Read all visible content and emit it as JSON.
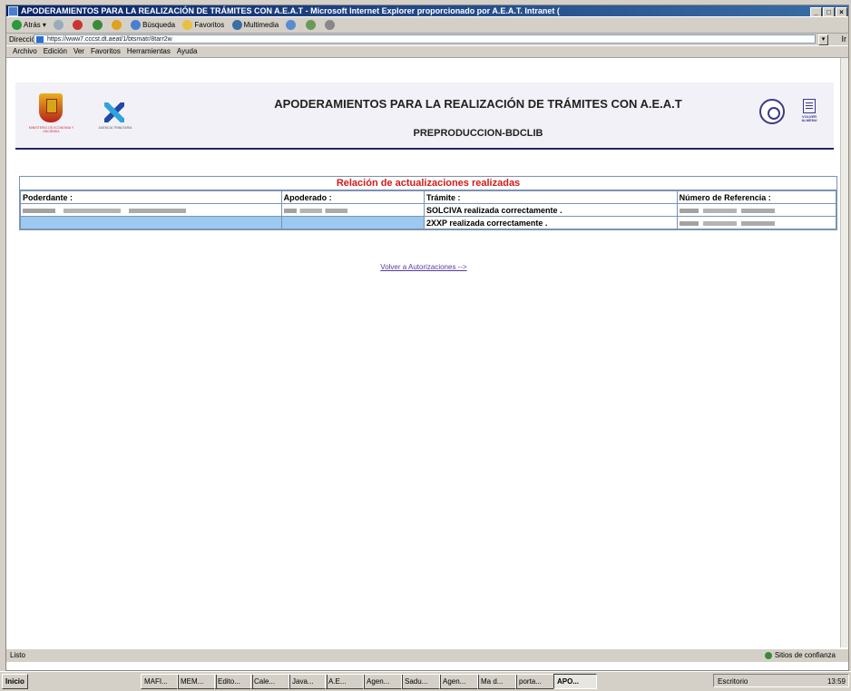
{
  "window": {
    "title": "APODERAMIENTOS PARA LA REALIZACIÓN DE TRÁMITES CON A.E.A.T - Microsoft Internet Explorer proporcionado por A.E.A.T. Intranet (",
    "controls": [
      "_",
      "□",
      "×"
    ]
  },
  "toolbar": {
    "back": "Atrás",
    "search": "Búsqueda",
    "favorites": "Favoritos",
    "multimedia": "Multimedia"
  },
  "address": {
    "label": "Dirección",
    "value": "https://www7.cccst.dt.aeat/1/btsmatr/8tarr2w",
    "go": "Ir"
  },
  "menu": [
    "Archivo",
    "Edición",
    "Ver",
    "Favoritos",
    "Herramientas",
    "Ayuda"
  ],
  "header": {
    "title": "APODERAMIENTOS PARA LA REALIZACIÓN DE TRÁMITES CON A.E.A.T",
    "subtitle": "PREPRODUCCION-BDCLIB",
    "min_text": "MINISTERIO DE ECONOMIA Y HACIENDA",
    "aeat_text": "AGENCIA TRIBUTARIA",
    "volver_text": "VOLVER ALMENU"
  },
  "results": {
    "title": "Relación de actualizaciones realizadas",
    "columns": [
      "Poderdante :",
      "Apoderado :",
      "Trámite :",
      "Número de Referencia :"
    ],
    "rows": [
      {
        "tramite": "SOLCIVA   realizada correctamente ."
      },
      {
        "tramite": "2XXP   realizada correctamente ."
      }
    ]
  },
  "link": {
    "label": "Volver a Autorizaciones -->"
  },
  "statusbar": {
    "left": "Listo",
    "right": "Sitios de confianza"
  },
  "taskbar": {
    "start": "Inicio",
    "tasks": [
      "MAFI...",
      "MEM...",
      "Edito...",
      "Cale...",
      "Java...",
      "A.E...",
      "Agen...",
      "Sadu...",
      "Agen...",
      "Ma d...",
      "porta...",
      "APO..."
    ],
    "tray_label": "Escritorio",
    "clock": "13:59"
  }
}
